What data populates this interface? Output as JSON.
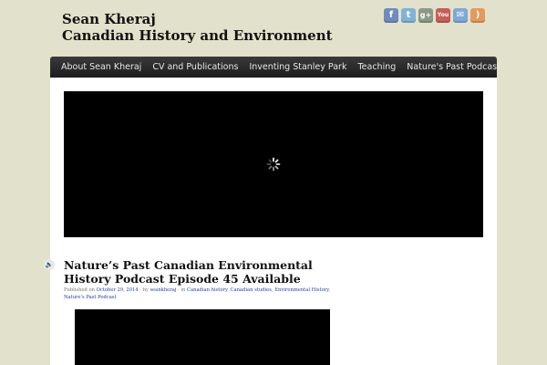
{
  "site": {
    "author": "Sean Kheraj",
    "tagline": "Canadian History and Environment"
  },
  "social": [
    {
      "icon": "facebook-icon",
      "glyph": "f",
      "color": "#6f8bbf"
    },
    {
      "icon": "twitter-icon",
      "glyph": "t",
      "color": "#7fb3d6"
    },
    {
      "icon": "google-plus-icon",
      "glyph": "g+",
      "color": "#8a9a86"
    },
    {
      "icon": "youtube-icon",
      "glyph": "You",
      "color": "#c85c57"
    },
    {
      "icon": "email-icon",
      "glyph": "✉",
      "color": "#7ea8d6"
    },
    {
      "icon": "rss-icon",
      "glyph": ")",
      "color": "#e39b5c"
    }
  ],
  "nav": {
    "items": [
      "About Sean Kheraj",
      "CV and Publications",
      "Inventing Stanley Park",
      "Teaching",
      "Nature's Past Podcast"
    ]
  },
  "post": {
    "title": "Nature’s Past Canadian Environmental History Podcast Episode 45 Available",
    "meta": {
      "published_on": "Published on",
      "date": "October 29, 2014",
      "by": "· by",
      "author": "seankheraj",
      "in": "· in",
      "categories": [
        "Canadian history",
        "Canadian studies",
        "Environmental History",
        "Nature's Past Podcast"
      ]
    }
  }
}
